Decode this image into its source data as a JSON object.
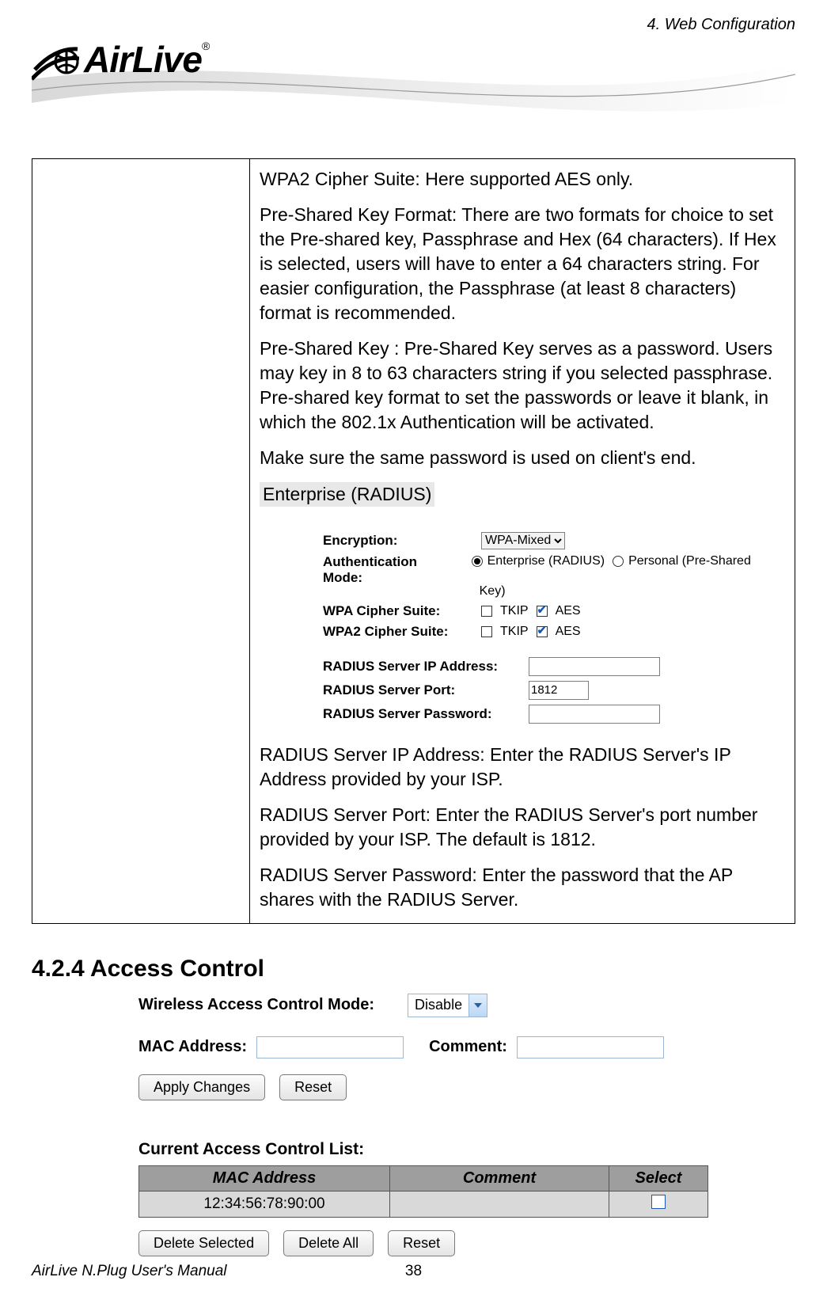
{
  "header": {
    "chapter_label": "4. Web Configuration",
    "logo_text": "AirLive",
    "logo_reg": "®"
  },
  "desc": {
    "wpa2_cipher": "WPA2 Cipher Suite: Here supported AES only.",
    "psk_format": "Pre-Shared Key Format: There are two formats for choice to set the Pre-shared key, Passphrase and Hex (64 characters). If Hex is selected, users will have to enter a 64 characters string. For easier configuration, the Passphrase (at least 8 characters) format is recommended.",
    "psk": "Pre-Shared Key : Pre-Shared Key serves as a password. Users may key in 8 to 63 characters string if you selected passphrase. Pre-shared key format to set the passwords or leave it blank, in which the 802.1x Authentication will be activated.",
    "same_pw": "Make sure the same password is used on client's end.",
    "enterprise_label": "Enterprise (RADIUS)"
  },
  "radius": {
    "encryption_label": "Encryption:",
    "encryption_value": "WPA-Mixed",
    "auth_label1": "Authentication",
    "auth_label2": "Mode:",
    "auth_enterprise_label": "Enterprise (RADIUS)",
    "auth_personal_label": "Personal (Pre-Shared",
    "auth_personal_label_line2": "Key)",
    "wpa_cipher_label": "WPA Cipher Suite:",
    "wpa2_cipher_label": "WPA2 Cipher Suite:",
    "tkip_label": "TKIP",
    "aes_label": "AES",
    "server_ip_label": "RADIUS Server IP Address:",
    "server_port_label": "RADIUS Server Port:",
    "server_port_value": "1812",
    "server_pw_label": "RADIUS Server Password:"
  },
  "desc2": {
    "radius_ip": "RADIUS Server IP Address: Enter the RADIUS Server's IP Address provided by your ISP.",
    "radius_port": "RADIUS Server Port: Enter the RADIUS Server's port number provided by your ISP. The default is 1812.",
    "radius_pw": "RADIUS Server Password: Enter the password that the AP shares with the RADIUS Server."
  },
  "section_heading": "4.2.4 Access Control",
  "access_control": {
    "mode_label": "Wireless Access Control Mode:",
    "mode_value": "Disable",
    "mac_label": "MAC Address:",
    "comment_label": "Comment:",
    "apply_btn": "Apply Changes",
    "reset_btn": "Reset",
    "list_heading": "Current Access Control List:",
    "columns": [
      "MAC Address",
      "Comment",
      "Select"
    ],
    "rows": [
      {
        "mac": "12:34:56:78:90:00",
        "comment": "",
        "selected": false
      }
    ],
    "delete_selected_btn": "Delete Selected",
    "delete_all_btn": "Delete All",
    "reset2_btn": "Reset"
  },
  "footer": {
    "left": "AirLive N.Plug User's Manual",
    "page": "38"
  }
}
